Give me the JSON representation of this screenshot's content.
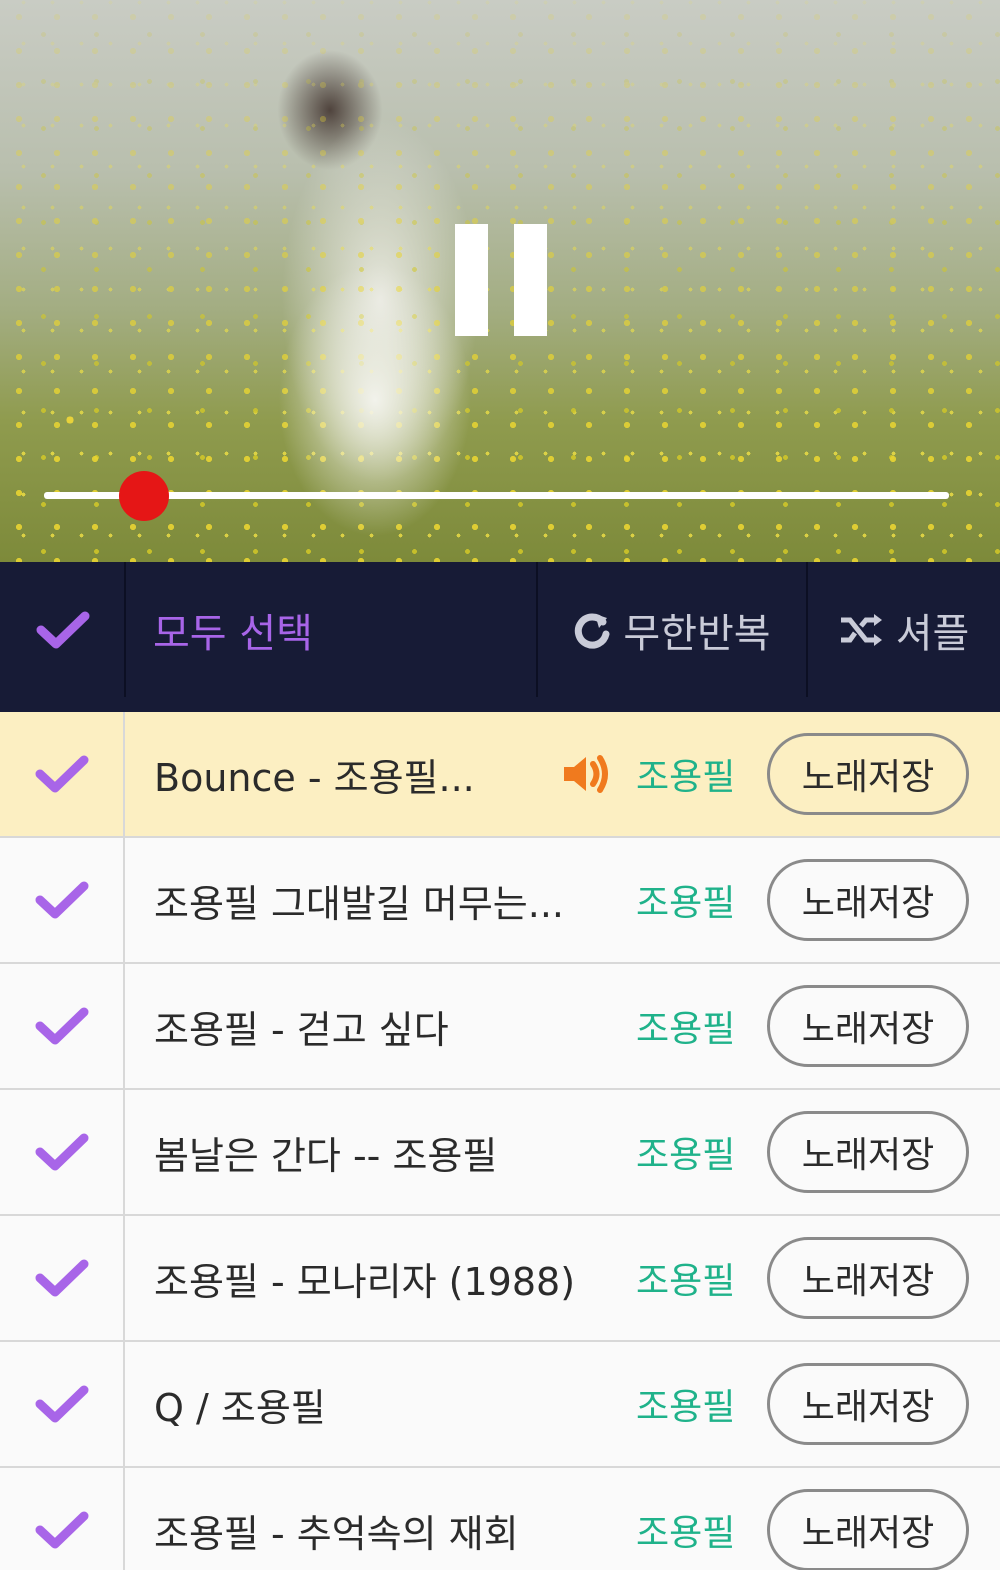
{
  "player": {
    "progress_fraction": 0.11,
    "pause_icon": "pause-icon"
  },
  "toolbar": {
    "select_all_label": "모두 선택",
    "repeat_label": "무한반복",
    "shuffle_label": "셔플"
  },
  "colors": {
    "accent_purple": "#a865e8",
    "artist_green": "#1fb28a",
    "toolbar_bg": "#171b36",
    "active_row_bg": "#fcefc2",
    "seek_thumb": "#e51616"
  },
  "songs": [
    {
      "title": "Bounce - 조용필...",
      "artist": "조용필",
      "save_label": "노래저장",
      "playing": true
    },
    {
      "title": "조용필 그대발길 머무는...",
      "artist": "조용필",
      "save_label": "노래저장",
      "playing": false
    },
    {
      "title": "조용필 - 걷고 싶다",
      "artist": "조용필",
      "save_label": "노래저장",
      "playing": false
    },
    {
      "title": "봄날은 간다 -- 조용필",
      "artist": "조용필",
      "save_label": "노래저장",
      "playing": false
    },
    {
      "title": "조용필 - 모나리자 (1988)",
      "artist": "조용필",
      "save_label": "노래저장",
      "playing": false
    },
    {
      "title": "Q / 조용필",
      "artist": "조용필",
      "save_label": "노래저장",
      "playing": false
    },
    {
      "title": "조용필 - 추억속의 재회",
      "artist": "조용필",
      "save_label": "노래저장",
      "playing": false
    }
  ]
}
